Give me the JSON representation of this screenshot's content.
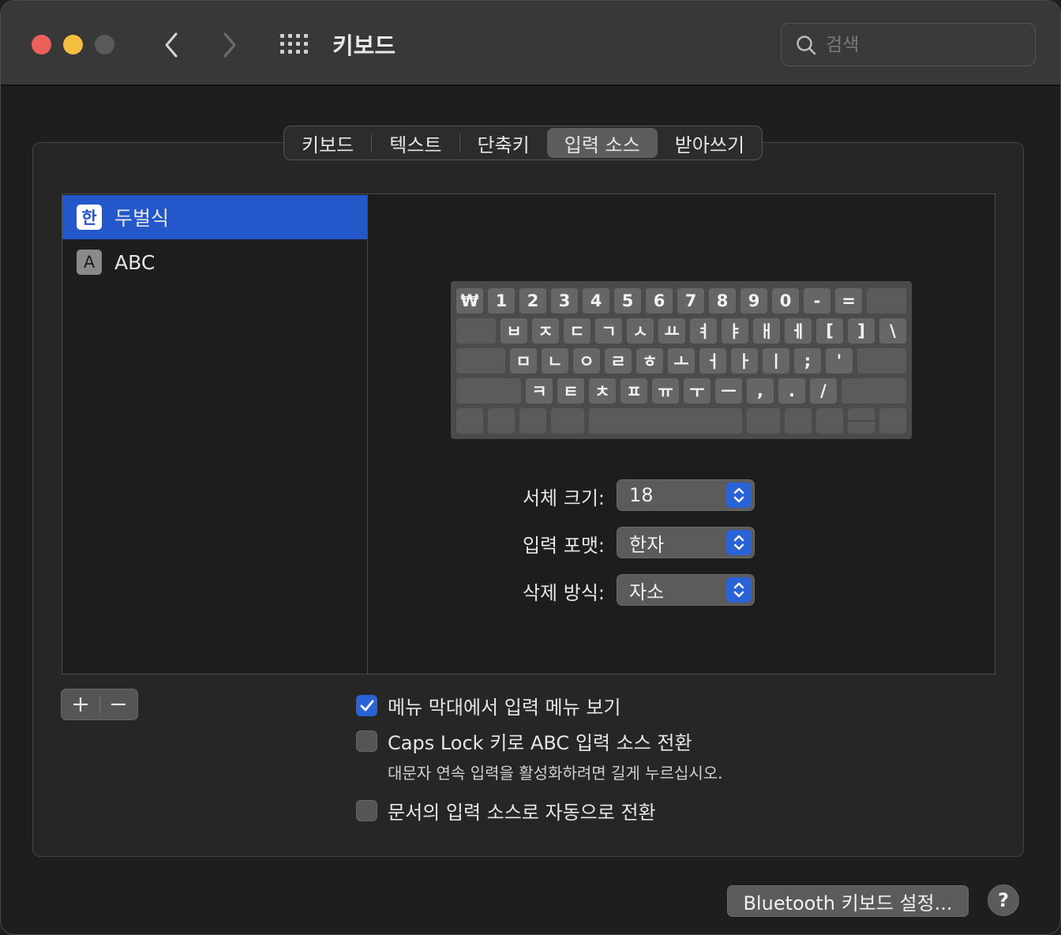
{
  "window": {
    "title": "키보드"
  },
  "search": {
    "placeholder": "검색"
  },
  "tabs": [
    {
      "label": "키보드",
      "active": false
    },
    {
      "label": "텍스트",
      "active": false
    },
    {
      "label": "단축키",
      "active": false
    },
    {
      "label": "입력 소스",
      "active": true
    },
    {
      "label": "받아쓰기",
      "active": false
    }
  ],
  "sources": [
    {
      "badge": "한",
      "label": "두벌식",
      "selected": true
    },
    {
      "badge": "A",
      "label": "ABC",
      "selected": false
    }
  ],
  "keyboard": {
    "row1": [
      "₩",
      "1",
      "2",
      "3",
      "4",
      "5",
      "6",
      "7",
      "8",
      "9",
      "0",
      "-",
      "=",
      ""
    ],
    "row2": [
      "",
      "ㅂ",
      "ㅈ",
      "ㄷ",
      "ㄱ",
      "ㅅ",
      "ㅛ",
      "ㅕ",
      "ㅑ",
      "ㅐ",
      "ㅔ",
      "[",
      "]",
      "\\"
    ],
    "row3": [
      "",
      "ㅁ",
      "ㄴ",
      "ㅇ",
      "ㄹ",
      "ㅎ",
      "ㅗ",
      "ㅓ",
      "ㅏ",
      "ㅣ",
      ";",
      "'",
      ""
    ],
    "row4": [
      "",
      "ㅋ",
      "ㅌ",
      "ㅊ",
      "ㅍ",
      "ㅠ",
      "ㅜ",
      "ㅡ",
      ",",
      ".",
      "/",
      ""
    ]
  },
  "settings": {
    "font_size": {
      "label": "서체 크기:",
      "value": "18"
    },
    "input_format": {
      "label": "입력 포맷:",
      "value": "한자"
    },
    "delete_mode": {
      "label": "삭제 방식:",
      "value": "자소"
    }
  },
  "list_controls": {
    "add": "+",
    "remove": "−"
  },
  "options": {
    "show_menu": {
      "label": "메뉴 막대에서 입력 메뉴 보기",
      "checked": true
    },
    "caps_lock": {
      "label": "Caps Lock 키로 ABC 입력 소스 전환",
      "checked": false,
      "hint": "대문자 연속 입력을 활성화하려면 길게 누르십시오."
    },
    "auto_switch": {
      "label": "문서의 입력 소스로 자동으로 전환",
      "checked": false
    }
  },
  "buttons": {
    "bluetooth": "Bluetooth 키보드 설정...",
    "help": "?"
  }
}
